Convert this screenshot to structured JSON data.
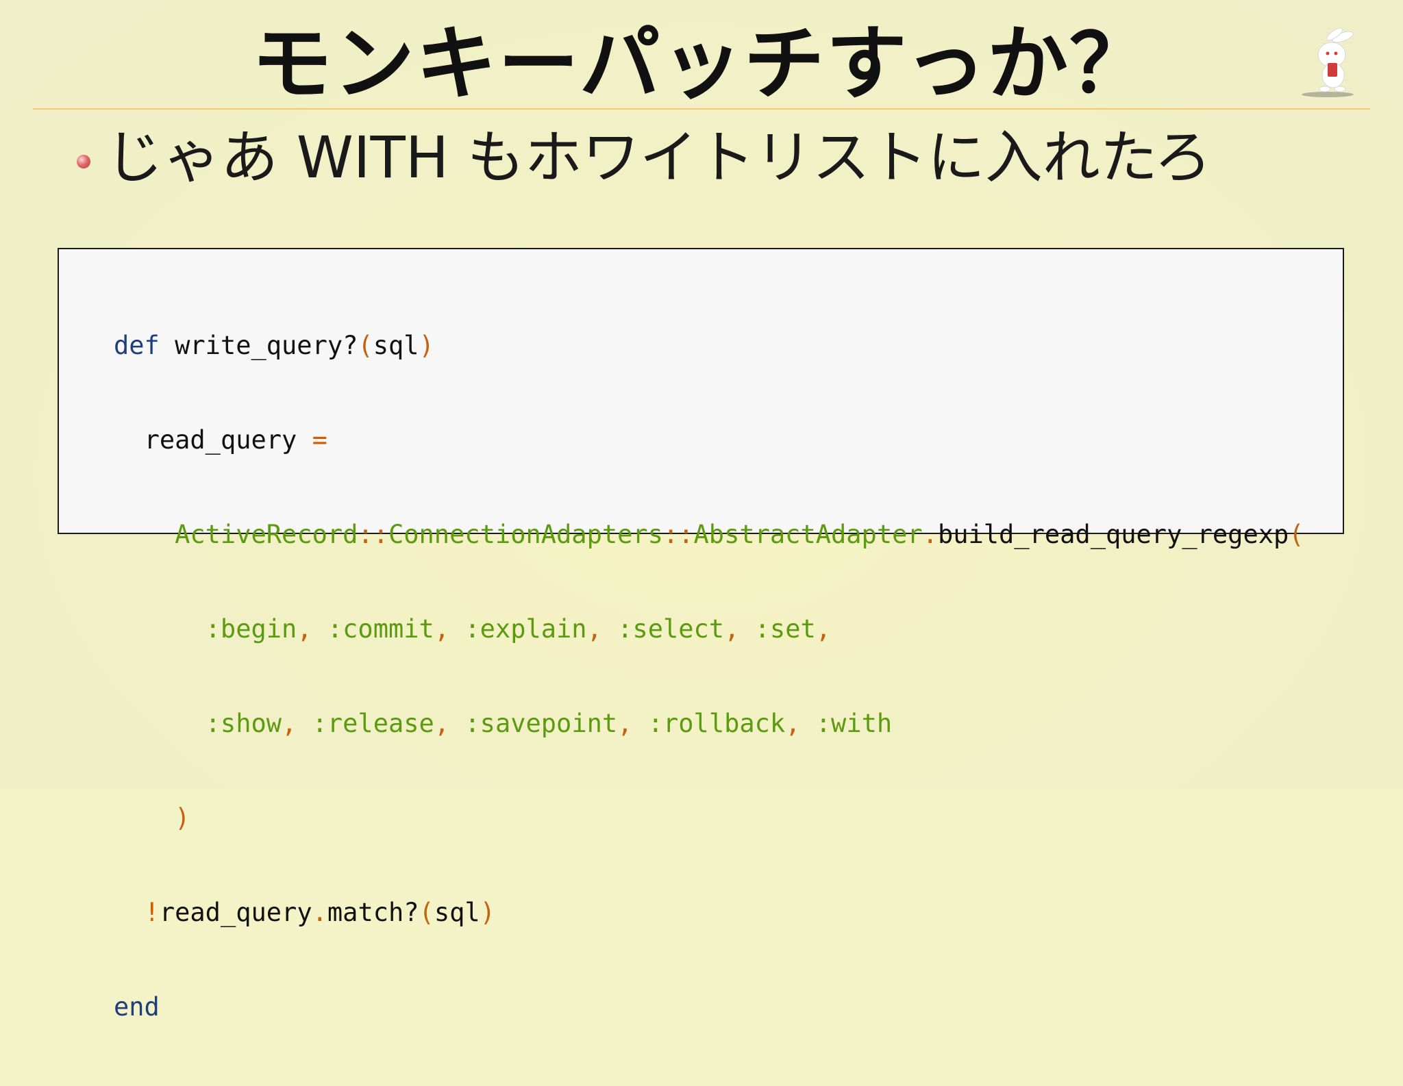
{
  "slide": {
    "title": "モンキーパッチすっか？",
    "bullet": "じゃあ WITH もホワイトリストに入れたろ",
    "mascot_icon": "rabbit-mascot-icon",
    "colors": {
      "background": "#f4f3c8",
      "rule": "#f2c877",
      "keyword": "#1f3e7a",
      "paren": "#c46210",
      "symbol": "#5c9a10"
    }
  },
  "code": {
    "line1": {
      "kw_def": "def",
      "name": " write_query?",
      "lparen": "(",
      "arg": "sql",
      "rparen": ")"
    },
    "line2": {
      "indent": "  ",
      "var": "read_query",
      "space": " ",
      "eq": "="
    },
    "line3": {
      "indent": "    ",
      "c1": "ActiveRecord",
      "sep1": "::",
      "c2": "ConnectionAdapters",
      "sep2": "::",
      "c3": "AbstractAdapter",
      "dot": ".",
      "method": "build_read_query_regexp",
      "lparen": "("
    },
    "line4": {
      "indent": "      ",
      "s1": ":begin",
      "c1": ",",
      "sp1": " ",
      "s2": ":commit",
      "c2": ",",
      "sp2": " ",
      "s3": ":explain",
      "c3": ",",
      "sp3": " ",
      "s4": ":select",
      "c4": ",",
      "sp4": " ",
      "s5": ":set",
      "c5": ","
    },
    "line5": {
      "indent": "      ",
      "s1": ":show",
      "c1": ",",
      "sp1": " ",
      "s2": ":release",
      "c2": ",",
      "sp2": " ",
      "s3": ":savepoint",
      "c3": ",",
      "sp3": " ",
      "s4": ":rollback",
      "c4": ",",
      "sp4": " ",
      "s5": ":with"
    },
    "line6": {
      "indent": "    ",
      "rparen": ")"
    },
    "line7": {
      "indent": "  ",
      "bang": "!",
      "var": "read_query",
      "dot": ".",
      "method": "match?",
      "lparen": "(",
      "arg": "sql",
      "rparen": ")"
    },
    "line8": {
      "kw_end": "end"
    }
  }
}
